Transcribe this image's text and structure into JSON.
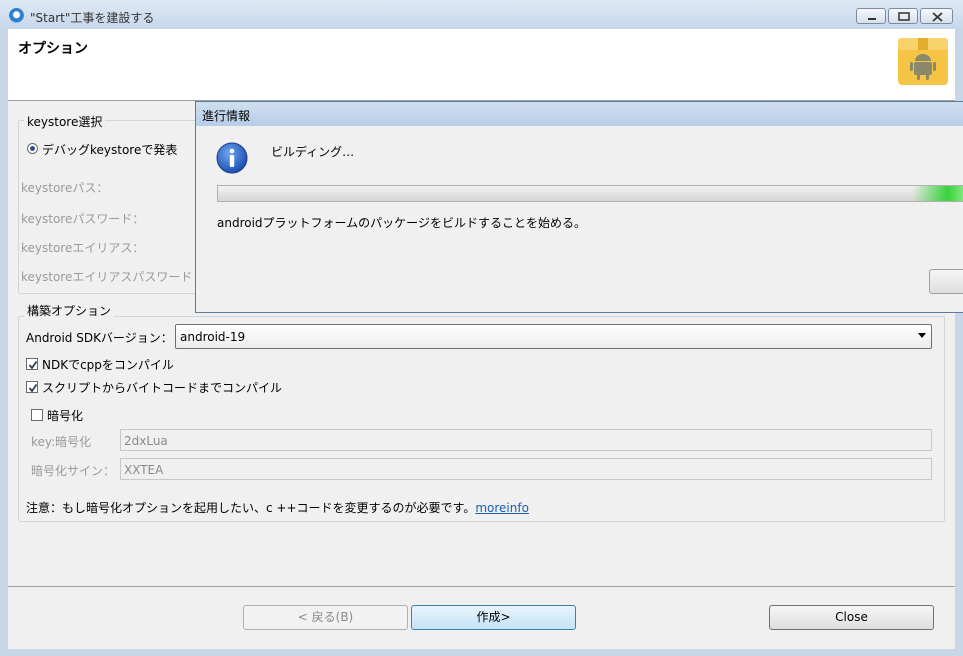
{
  "window": {
    "title": "\"Start\"工事を建設する"
  },
  "header": {
    "page_title": "オプション"
  },
  "keystore": {
    "legend": "keystore選択",
    "radio_debug": "デバッグkeystoreで発表",
    "path_label": "keystoreパス：",
    "password_label": "keystoreパスワード：",
    "alias_label": "keystoreエイリアス：",
    "alias_password_label": "keystoreエイリアスパスワード"
  },
  "build": {
    "legend": "構築オプション",
    "sdk_label": "Android SDKバージョン：",
    "sdk_value": "android-19",
    "ndk_checkbox": "NDKでcppをコンパイル",
    "ndk_checked": true,
    "script_checkbox": "スクリプトからバイトコードまでコンパイル",
    "script_checked": true,
    "encrypt_checkbox": "暗号化",
    "encrypt_checked": false,
    "key_label": "key:暗号化",
    "key_value": "2dxLua",
    "sign_label": "暗号化サイン：",
    "sign_value": "XXTEA",
    "note": "注意：もし暗号化オプションを起用したい、c ++コードを変更するのが必要です。",
    "moreinfo": "moreinfo"
  },
  "footer": {
    "back": "< 戻る(B)",
    "create": "作成>",
    "close": "Close"
  },
  "progress_dialog": {
    "title": "進行情報",
    "message": "ビルディング…",
    "status": "androidプラットフォームのパッケージをビルドすることを始める。"
  },
  "colors": {
    "accent": "#3c7fb1",
    "link": "#1a5fb4",
    "progress": "#37d33a"
  }
}
